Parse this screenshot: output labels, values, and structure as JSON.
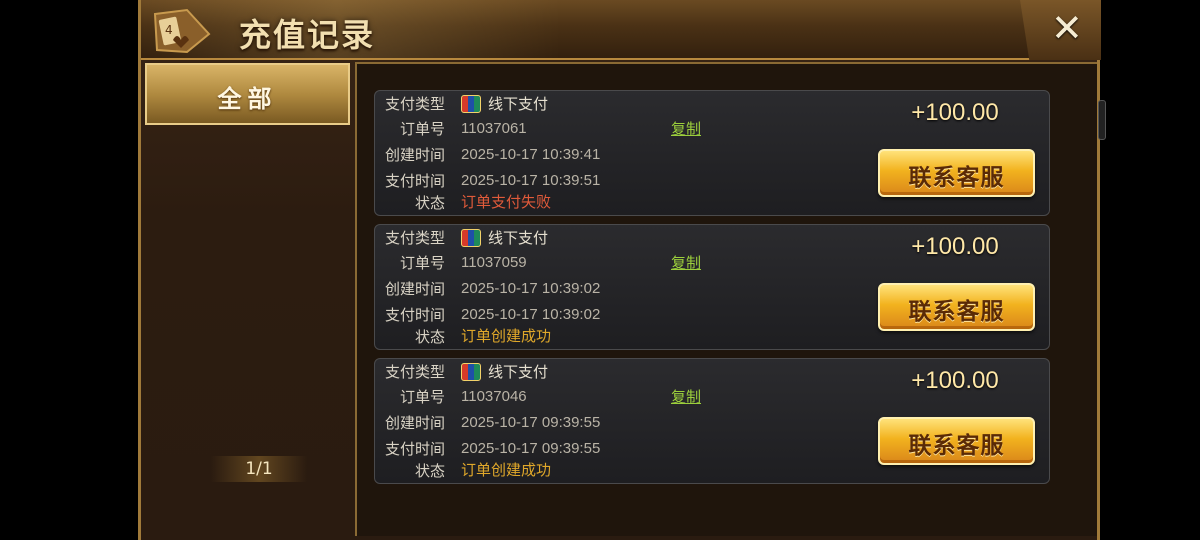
{
  "header": {
    "title": "充值记录",
    "close_label": "✕"
  },
  "sidebar": {
    "tabs": [
      {
        "label": "全部"
      }
    ],
    "pager": "1/1"
  },
  "labels": {
    "pay_type": "支付类型",
    "order_no": "订单号",
    "created": "创建时间",
    "paid": "支付时间",
    "status": "状态",
    "copy": "复制",
    "contact": "联系客服"
  },
  "records": [
    {
      "pay_type": "线下支付",
      "order_no": "11037061",
      "created": "2025-10-17 10:39:41",
      "paid": "2025-10-17 10:39:51",
      "status": "订单支付失败",
      "amount": "+100.00"
    },
    {
      "pay_type": "线下支付",
      "order_no": "11037059",
      "created": "2025-10-17 10:39:02",
      "paid": "2025-10-17 10:39:02",
      "status": "订单创建成功",
      "amount": "+100.00"
    },
    {
      "pay_type": "线下支付",
      "order_no": "11037046",
      "created": "2025-10-17 09:39:55",
      "paid": "2025-10-17 09:39:55",
      "status": "订单创建成功",
      "amount": "+100.00"
    }
  ],
  "icons": {
    "pay_type": "unionpay-icon",
    "close": "close-icon"
  },
  "colors": {
    "status_fail": "#e05a3a",
    "status_ok": "#e0a82a",
    "copy_link": "#9ccf3c",
    "gold": "#f2b21e"
  }
}
